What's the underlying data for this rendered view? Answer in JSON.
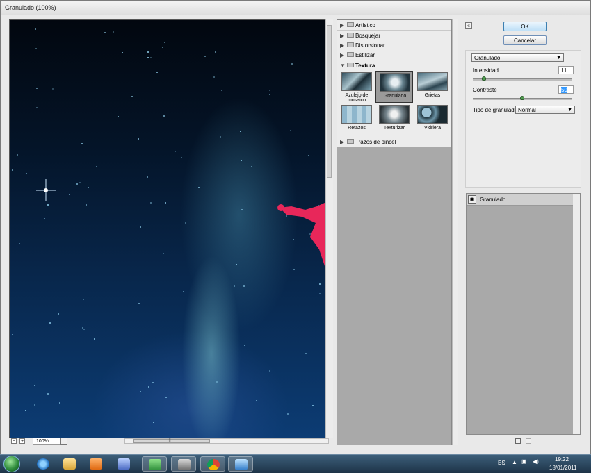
{
  "window": {
    "title": "Granulado (100%)"
  },
  "preview": {
    "zoom": "100%",
    "zoom_out": "−",
    "zoom_in": "+",
    "scroll_grip": "|||"
  },
  "gallery": {
    "categories": [
      {
        "label": "Artístico",
        "open": false
      },
      {
        "label": "Bosquejar",
        "open": false
      },
      {
        "label": "Distorsionar",
        "open": false
      },
      {
        "label": "Estilizar",
        "open": false
      },
      {
        "label": "Textura",
        "open": true
      },
      {
        "label": "Trazos de pincel",
        "open": false
      }
    ],
    "thumbnails": [
      {
        "label": "Azulejo de mosaico",
        "selected": false
      },
      {
        "label": "Granulado",
        "selected": true
      },
      {
        "label": "Grietas",
        "selected": false
      },
      {
        "label": "Retazos",
        "selected": false
      },
      {
        "label": "Texturizar",
        "selected": false
      },
      {
        "label": "Vidriera",
        "selected": false
      }
    ]
  },
  "buttons": {
    "ok": "OK",
    "cancel": "Cancelar",
    "collapse": "«"
  },
  "settings": {
    "filter_select": "Granulado",
    "intensity_label": "Intensidad",
    "intensity_value": "11",
    "intensity_fraction": 0.11,
    "contrast_label": "Contraste",
    "contrast_value": "50",
    "contrast_fraction": 0.5,
    "grain_type_label": "Tipo de granulado:",
    "grain_type_value": "Normal"
  },
  "layers": [
    {
      "name": "Granulado",
      "visible": true
    }
  ],
  "taskbar": {
    "apps": [
      "start-orb",
      "internet-explorer",
      "file-explorer",
      "media-player",
      "utility-tool",
      "messenger",
      "screen-capture",
      "chrome",
      "drawing-app"
    ],
    "language": "ES",
    "time": "19:22",
    "date": "18/01/2011"
  },
  "colors": {
    "accent_ok": "#bfe0f7",
    "taskbar": "#1d3347",
    "panel": "#a9a9a9"
  }
}
